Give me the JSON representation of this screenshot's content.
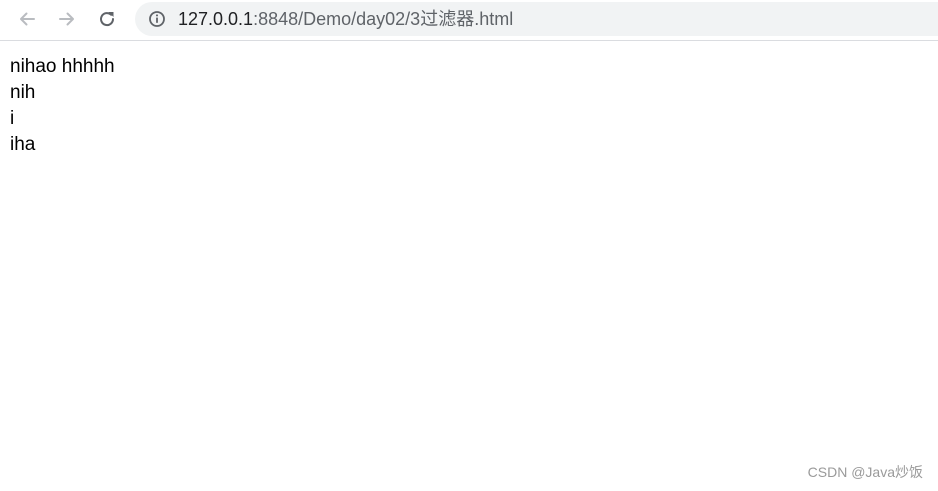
{
  "browser": {
    "url_host": "127.0.0.1",
    "url_path": ":8848/Demo/day02/3过滤器.html",
    "icons": {
      "back": "back-arrow-icon",
      "forward": "forward-arrow-icon",
      "reload": "reload-icon",
      "info": "info-icon"
    }
  },
  "page": {
    "lines": [
      "nihao hhhhh",
      "nih",
      "i",
      "iha"
    ]
  },
  "watermark": "CSDN @Java炒饭"
}
